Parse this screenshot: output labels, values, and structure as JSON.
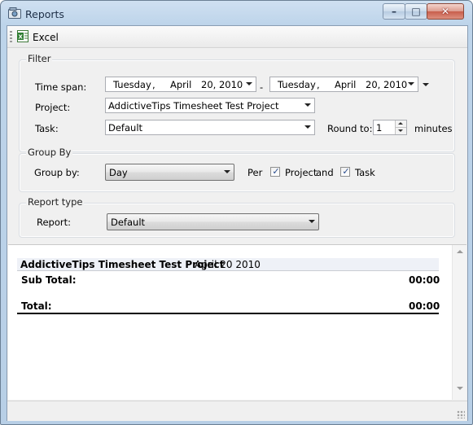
{
  "window": {
    "title": "Reports",
    "colors": {
      "frame": "#bdd4ea",
      "close": "#c85e4c"
    }
  },
  "toolbar": {
    "excel_label": "Excel"
  },
  "filter": {
    "title": "Filter",
    "timespan_label": "Time span:",
    "start_date": {
      "weekday": "Tuesday",
      "sep1": ",",
      "month": "April",
      "day_year": "20, 2010"
    },
    "range_sep": "-",
    "end_date": {
      "weekday": "Tuesday",
      "sep1": ",",
      "month": "April",
      "day_year": "20, 2010"
    },
    "project_label": "Project:",
    "project_value": "AddictiveTips Timesheet Test Project",
    "task_label": "Task:",
    "task_value": "Default",
    "round_label": "Round to:",
    "round_value": "1",
    "minutes_label": "minutes"
  },
  "groupby": {
    "title": "Group By",
    "label": "Group by:",
    "value": "Day",
    "per_label": "Per",
    "project_check": {
      "label": "Project",
      "checked": true
    },
    "and_label": "and",
    "task_check": {
      "label": "Task",
      "checked": true
    }
  },
  "reporttype": {
    "title": "Report type",
    "label": "Report:",
    "value": "Default"
  },
  "report": {
    "project_name": "AddictiveTips Timesheet Test Project",
    "date": "April 20 2010",
    "subtotal_label": "Sub Total:",
    "subtotal_value": "00:00",
    "total_label": "Total:",
    "total_value": "00:00"
  }
}
